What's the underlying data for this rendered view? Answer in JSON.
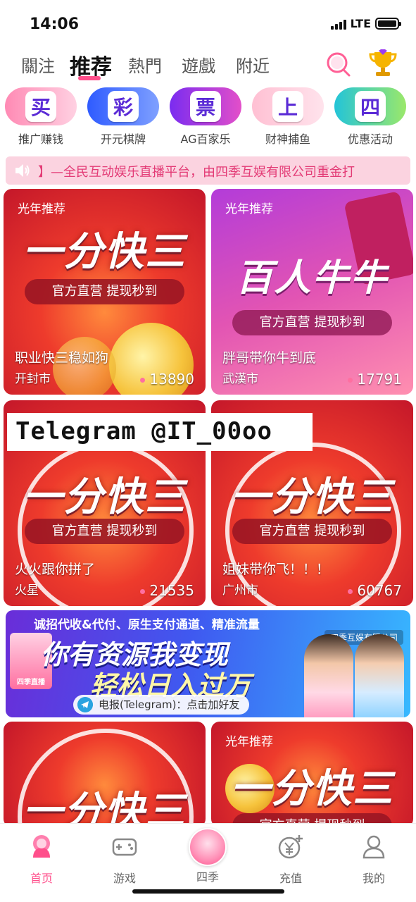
{
  "status_bar": {
    "time": "14:06",
    "network": "LTE"
  },
  "top_nav": {
    "tabs": [
      {
        "label": "關注",
        "active": false
      },
      {
        "label": "推荐",
        "active": true
      },
      {
        "label": "熱門",
        "active": false
      },
      {
        "label": "遊戲",
        "active": false
      },
      {
        "label": "附近",
        "active": false
      }
    ],
    "search_icon": "search-icon",
    "trophy_icon": "trophy-icon",
    "accent": "#ff4f8b"
  },
  "shortcuts": [
    {
      "glyph": "买",
      "label": "推广赚钱",
      "color": "#ff6fa0"
    },
    {
      "glyph": "彩",
      "label": "开元棋牌",
      "color": "#3b6cff"
    },
    {
      "glyph": "票",
      "label": "AG百家乐",
      "color": "#b53ce3"
    },
    {
      "glyph": "上",
      "label": "财神捕鱼",
      "color": "#ffb3c8"
    },
    {
      "glyph": "四",
      "label": "优惠活动",
      "color": "#2ec7d9"
    }
  ],
  "marquee": {
    "text": "】—全民互动娱乐直播平台，由四季互娱有限公司重金打"
  },
  "cards": [
    {
      "tag": "光年推荐",
      "headline": "一分快三",
      "sub": "官方直营 提现秒到",
      "title": "职业快三稳如狗",
      "city": "开封市",
      "count": "13890",
      "style": "red"
    },
    {
      "tag": "光年推荐",
      "headline": "百人牛牛",
      "sub": "官方直营 提现秒到",
      "title": "胖哥带你牛到底",
      "city": "武漢市",
      "count": "17791",
      "style": "pink"
    },
    {
      "tag": "",
      "headline": "一分快三",
      "sub": "官方直营 提现秒到",
      "title": "火火跟你拼了",
      "city": "火星",
      "count": "21535",
      "style": "red"
    },
    {
      "tag": "",
      "headline": "一分快三",
      "sub": "官方直营 提现秒到",
      "title": "姐妹带你飞！！！",
      "city": "广州市",
      "count": "60767",
      "style": "red"
    },
    {
      "tag": "",
      "headline": "一分快三",
      "sub": "",
      "title": "",
      "city": "",
      "count": "",
      "style": "red"
    },
    {
      "tag": "光年推荐",
      "headline": "一分快三",
      "sub": "官方直营 提现秒到",
      "title": "",
      "city": "",
      "count": "",
      "style": "red"
    }
  ],
  "watermark": {
    "text": "Telegram @IT_00oo"
  },
  "ad_banner": {
    "line1": "诚招代收&代付、原生支付通道、精准流量",
    "company": "四季互娱有限公司",
    "headline1": "你有资源我变现",
    "headline2": "轻松日入过万",
    "telegram": "电报(Telegram)：点击加好友",
    "thumb_label": "四季直播"
  },
  "tab_bar": [
    {
      "label": "首页",
      "icon": "home-icon",
      "active": true
    },
    {
      "label": "游戏",
      "icon": "gamepad-icon",
      "active": false
    },
    {
      "label": "四季",
      "icon": "avatar",
      "active": false
    },
    {
      "label": "充值",
      "icon": "yuan-plus-icon",
      "active": false
    },
    {
      "label": "我的",
      "icon": "person-icon",
      "active": false
    }
  ]
}
